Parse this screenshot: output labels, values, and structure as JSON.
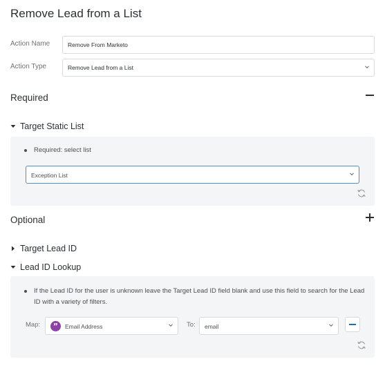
{
  "header": {
    "title": "Remove Lead from a List"
  },
  "form": {
    "action_name": {
      "label": "Action Name",
      "value": "Remove From Marketo"
    },
    "action_type": {
      "label": "Action Type",
      "value": "Remove Lead from a List"
    }
  },
  "required": {
    "heading": "Required",
    "toggle_icon": "minus-icon",
    "target_static_list": {
      "heading": "Target Static List",
      "expanded": true,
      "bullet": "Required: select list",
      "selected": "Exception List"
    }
  },
  "optional": {
    "heading": "Optional",
    "toggle_icon": "plus-icon",
    "target_lead_id": {
      "heading": "Target Lead ID",
      "expanded": false
    },
    "lead_id_lookup": {
      "heading": "Lead ID Lookup",
      "expanded": true,
      "bullet": "If the Lead ID for the user is unknown leave the Target Lead ID field blank and use this field to search for the Lead ID with a variety of filters.",
      "map_label": "Map:",
      "map_value": "Email Address",
      "map_icon": "quote-icon",
      "to_label": "To:",
      "to_value": "email"
    }
  },
  "colors": {
    "accent": "#4a90c8",
    "badge": "#8e3fa8",
    "button_blue": "#1b6eb8",
    "panel_bg": "#f4f5f6"
  }
}
